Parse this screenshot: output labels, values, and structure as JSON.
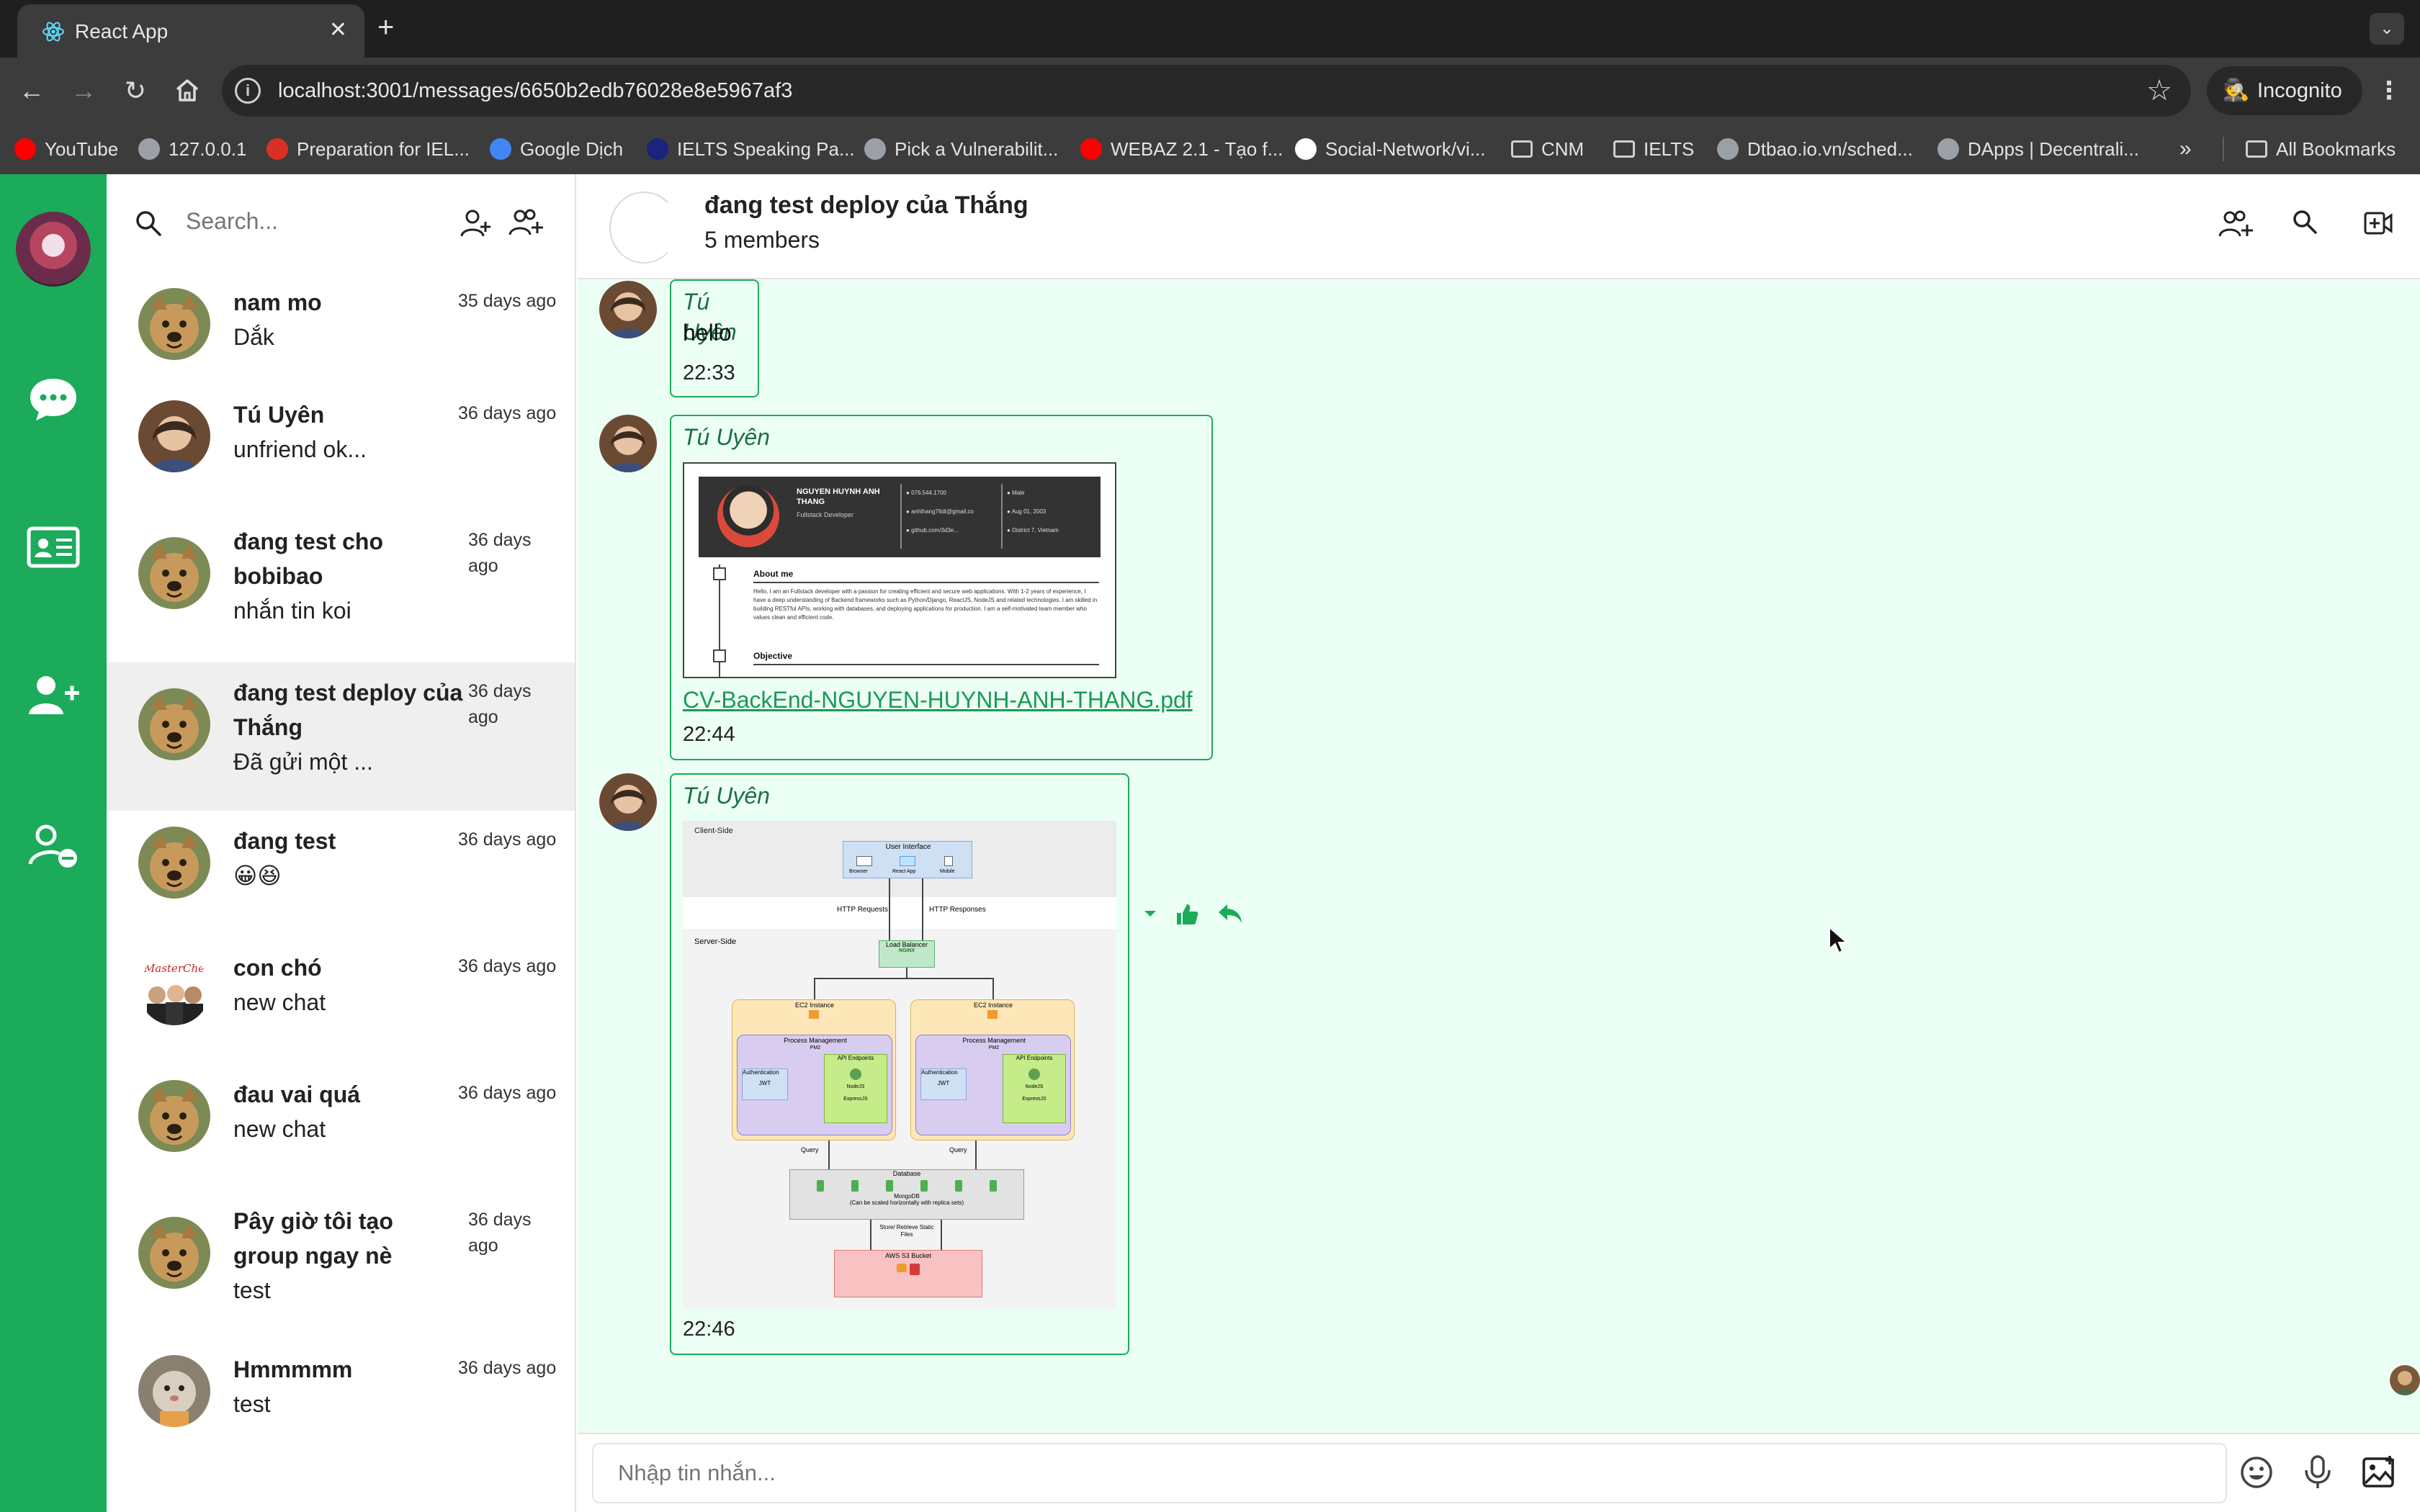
{
  "browser": {
    "tab_title": "React App",
    "url": "localhost:3001/messages/6650b2edb76028e8e5967af3",
    "incognito_label": "Incognito",
    "bookmarks": [
      {
        "label": "YouTube",
        "color": "#ff0000"
      },
      {
        "label": "127.0.0.1",
        "color": "#9aa0a6"
      },
      {
        "label": "Preparation for IEL...",
        "color": "#d93025"
      },
      {
        "label": "Google Dịch",
        "color": "#4285f4"
      },
      {
        "label": "IELTS Speaking Pa...",
        "color": "#1a237e"
      },
      {
        "label": "Pick a Vulnerabilit...",
        "color": "#9aa0a6"
      },
      {
        "label": "WEBAZ 2.1 - Tạo f...",
        "color": "#ff0000"
      },
      {
        "label": "Social-Network/vi...",
        "color": "#ffffff"
      },
      {
        "label": "CNM",
        "color": "folder"
      },
      {
        "label": "IELTS",
        "color": "folder"
      },
      {
        "label": "Dtbao.io.vn/sched...",
        "color": "#9aa0a6"
      },
      {
        "label": "DApps | Decentrali...",
        "color": "#9aa0a6"
      }
    ],
    "all_bookmarks_label": "All Bookmarks"
  },
  "app": {
    "brand_color": "#1bab5b",
    "search_placeholder": "Search...",
    "conversations": [
      {
        "name": "nam mo",
        "last": "Dắk",
        "time": "35 days ago",
        "avatar": "dog"
      },
      {
        "name": "Tú Uyên",
        "last": "unfriend ok...",
        "time": "36 days ago",
        "avatar": "girl"
      },
      {
        "name": "đang test cho bobibao",
        "last": "nhắn tin koi",
        "time": "36 days ago",
        "avatar": "dog"
      },
      {
        "name": "đang test deploy của Thắng",
        "last": "Đã gửi một ...",
        "time": "36 days ago",
        "avatar": "dog",
        "active": true
      },
      {
        "name": "đang test",
        "last": "😀😆",
        "time": "36 days ago",
        "avatar": "dog"
      },
      {
        "name": "con chó",
        "last": "new chat",
        "time": "36 days ago",
        "avatar": "masterchef"
      },
      {
        "name": "đau vai quá",
        "last": "new chat",
        "time": "36 days ago",
        "avatar": "dog"
      },
      {
        "name": "Pây giờ tôi tạo group ngay nè",
        "last": "test",
        "time": "36 days ago",
        "avatar": "dog"
      },
      {
        "name": "Hmmmmm",
        "last": "test",
        "time": "36 days ago",
        "avatar": "pet"
      }
    ],
    "chat": {
      "group_name": "đang test deploy của Thắng",
      "members": "5 members",
      "messages": [
        {
          "sender": "Tú Uyên",
          "text": "hello",
          "time": "22:33"
        },
        {
          "sender": "Tú Uyên",
          "file": "CV-BackEnd-NGUYEN-HUYNH-ANH-THANG.pdf",
          "time": "22:44",
          "preview": {
            "name": "NGUYEN HUYNH ANH THANG",
            "role": "Fullstack Developer",
            "phone": "076.544.1700",
            "email": "anhthang76dt@gmail.co",
            "web": "github.com/3d3e...",
            "dob": "Aug 01, 2003",
            "gender": "Male",
            "address": "District 7, Vietnam",
            "section1": "About me",
            "section2": "Objective",
            "about": "Hello, I am an Fullstack developer with a passion for creating efficient and secure web applications. With 1-2 years of experience, I have a deep understanding of Backend frameworks such as Python/Django, ReactJS, NodeJS and related technologies. I am skilled in building RESTful APIs, working with databases, and deploying applications for production. I am a self-motivated team member who values clean and efficient code."
          }
        },
        {
          "sender": "Tú Uyên",
          "time": "22:46",
          "diagram": {
            "client_side": "Client-Side",
            "user_interface": "User Interface",
            "browser": "Browser",
            "react_app": "React App",
            "mobile": "Mobile",
            "http_requests": "HTTP Requests",
            "http_responses": "HTTP Responses",
            "server_side": "Server-Side",
            "load_balancer": "Load Balancer",
            "nginx": "NGINX",
            "ec2": "EC2 Instance",
            "pm": "Process Management",
            "pm2": "PM2",
            "auth": "Authentication",
            "jwt": "JWT",
            "api": "API Endpoints",
            "nodejs": "NodeJS",
            "express": "ExpressJS",
            "query": "Query",
            "database": "Database",
            "mongodb": "MongoDB",
            "mongo_note": "(Can be scaled horizontally with replica sets)",
            "store": "Store/ Retrieve Static Files",
            "s3": "AWS S3 Bucket"
          }
        }
      ],
      "composer_placeholder": "Nhập tin nhắn..."
    }
  }
}
